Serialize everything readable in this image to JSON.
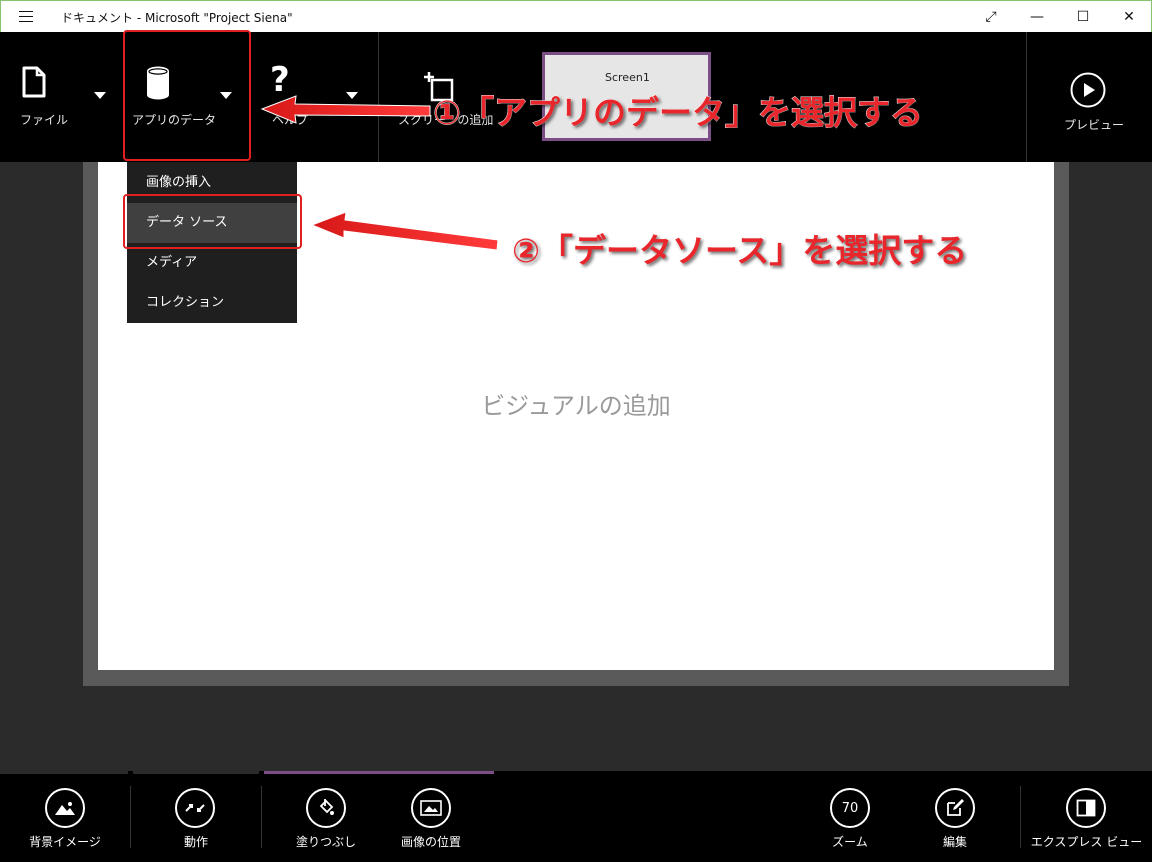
{
  "window": {
    "title": "ドキュメント - Microsoft \"Project Siena\"",
    "controls": {
      "restore_glyph": "⤢",
      "minimize_glyph": "—",
      "maximize_glyph": "☐",
      "close_glyph": "✕"
    }
  },
  "toolbar": {
    "file_label": "ファイル",
    "appdata_label": "アプリのデータ",
    "help_label": "ヘルプ",
    "add_screen_label": "スクリーンの追加",
    "thumbnail_label": "Screen1",
    "preview_label": "プレビュー"
  },
  "dropdown": {
    "items": [
      {
        "label": "画像の挿入"
      },
      {
        "label": "データ ソース"
      },
      {
        "label": "メディア"
      },
      {
        "label": "コレクション"
      }
    ]
  },
  "canvas": {
    "placeholder": "ビジュアルの追加"
  },
  "annotations": {
    "step1": "①「アプリのデータ」を選択する",
    "step2": "②「データソース」を選択する",
    "color": "#e8262b"
  },
  "bottombar": {
    "background_image_label": "背景イメージ",
    "action_label": "動作",
    "fill_label": "塗りつぶし",
    "image_position_label": "画像の位置",
    "zoom_value": "70",
    "zoom_label": "ズーム",
    "edit_label": "編集",
    "express_view_label": "エクスプレス ビュー"
  },
  "colors": {
    "accent": "#7b4f86",
    "toolbar_bg": "#000000",
    "workspace_bg": "#2b2b2b"
  }
}
